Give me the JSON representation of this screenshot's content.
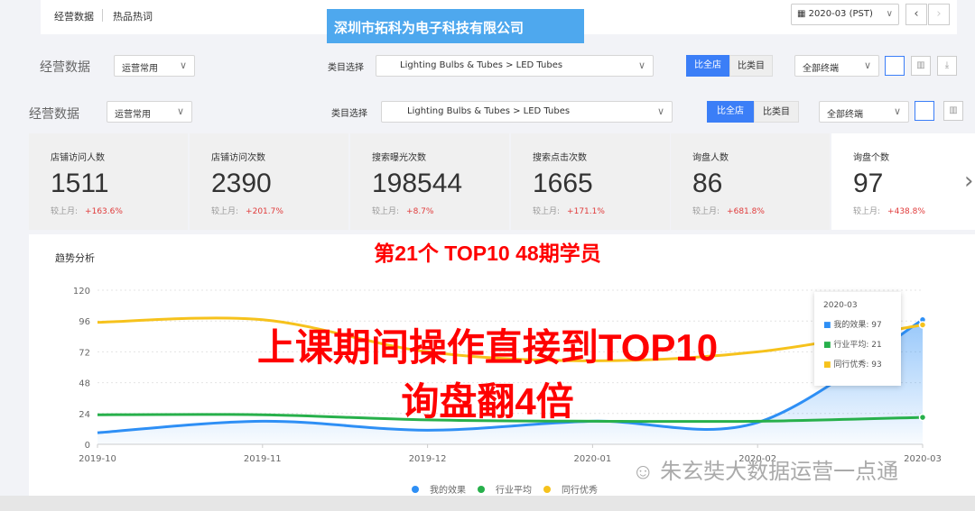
{
  "topbar": {
    "tabs": [
      "经营数据",
      "热品热词"
    ],
    "date": "2020-03 (PST)",
    "prev": "‹",
    "next": "›"
  },
  "banner": "深圳市拓科为电子科技有限公司",
  "filters": {
    "title": "经营数据",
    "preset": "运营常用",
    "category_label": "类目选择",
    "category": "Lighting Bulbs & Tubes > LED Tubes",
    "compare_store": "比全店",
    "compare_category": "比类目",
    "terminal": "全部终端"
  },
  "kpis": [
    {
      "title": "店铺访问人数",
      "value": "1511",
      "cmp_label": "较上月:",
      "change": "+163.6%"
    },
    {
      "title": "店铺访问次数",
      "value": "2390",
      "cmp_label": "较上月:",
      "change": "+201.7%"
    },
    {
      "title": "搜索曝光次数",
      "value": "198544",
      "cmp_label": "较上月:",
      "change": "+8.7%"
    },
    {
      "title": "搜索点击次数",
      "value": "1665",
      "cmp_label": "较上月:",
      "change": "+171.1%"
    },
    {
      "title": "询盘人数",
      "value": "86",
      "cmp_label": "较上月:",
      "change": "+681.8%"
    },
    {
      "title": "询盘个数",
      "value": "97",
      "cmp_label": "较上月:",
      "change": "+438.8%"
    }
  ],
  "overlay": {
    "headline": "第21个 TOP10 48期学员",
    "line1": "上课期间操作直接到TOP10",
    "line2": "询盘翻4倍",
    "watermark": "朱玄奘大数据运营一点通"
  },
  "chart_data": {
    "type": "line",
    "title": "趋势分析",
    "categories": [
      "2019-10",
      "2019-11",
      "2019-12",
      "2020-01",
      "2020-02",
      "2020-03"
    ],
    "yticks": [
      0,
      24,
      48,
      72,
      96,
      120
    ],
    "ylim": [
      0,
      120
    ],
    "grid": true,
    "legend": "bottom",
    "series": [
      {
        "name": "我的效果",
        "color": "#2e8ff5",
        "values": [
          9,
          18,
          11,
          18,
          17,
          97
        ]
      },
      {
        "name": "行业平均",
        "color": "#27b04b",
        "values": [
          23,
          23,
          19,
          18,
          18,
          21
        ]
      },
      {
        "name": "同行优秀",
        "color": "#f6c21c",
        "values": [
          95,
          97,
          72,
          65,
          72,
          93
        ]
      }
    ],
    "tooltip": {
      "title": "2020-03",
      "items": [
        "我的效果: 97",
        "行业平均: 21",
        "同行优秀: 93"
      ]
    }
  }
}
